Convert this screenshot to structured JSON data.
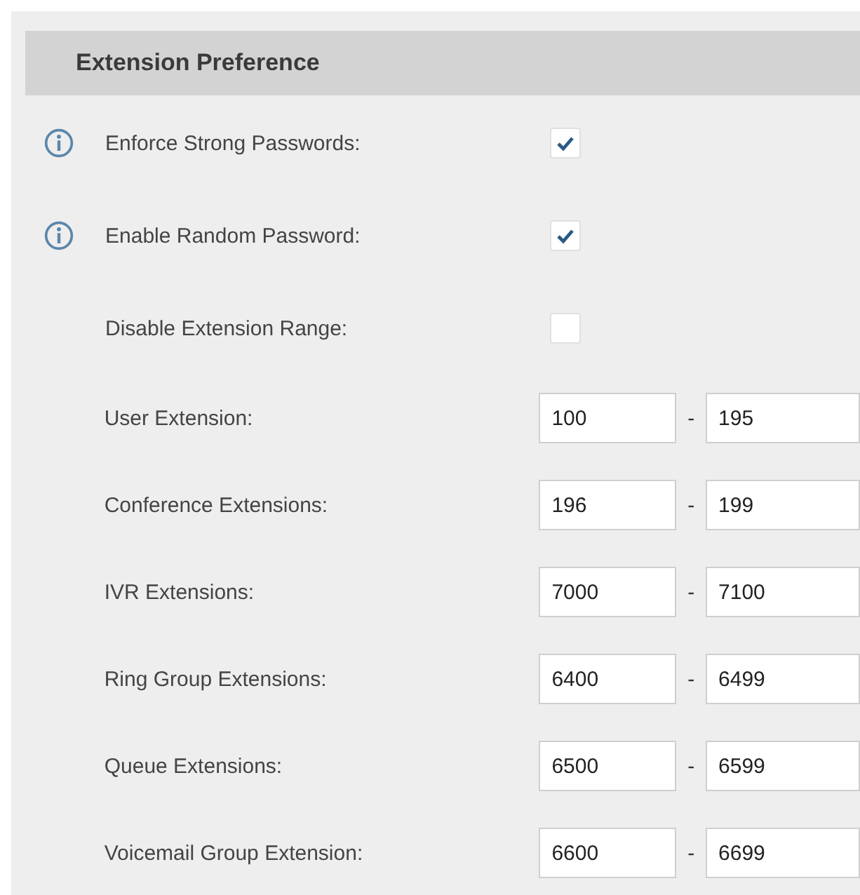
{
  "section": {
    "title": "Extension Preference"
  },
  "rows": [
    {
      "kind": "checkbox",
      "label": "Enforce Strong Passwords:",
      "info": true,
      "checked": true
    },
    {
      "kind": "checkbox",
      "label": "Enable Random Password:",
      "info": true,
      "checked": true
    },
    {
      "kind": "checkbox",
      "label": "Disable Extension Range:",
      "info": false,
      "checked": false
    },
    {
      "kind": "range",
      "label": "User Extension:",
      "start": "100",
      "separator": "-",
      "end": "195"
    },
    {
      "kind": "range",
      "label": "Conference Extensions:",
      "start": "196",
      "separator": "-",
      "end": "199"
    },
    {
      "kind": "range",
      "label": "IVR Extensions:",
      "start": "7000",
      "separator": "-",
      "end": "7100"
    },
    {
      "kind": "range",
      "label": "Ring Group Extensions:",
      "start": "6400",
      "separator": "-",
      "end": "6499"
    },
    {
      "kind": "range",
      "label": "Queue Extensions:",
      "start": "6500",
      "separator": "-",
      "end": "6599"
    },
    {
      "kind": "range",
      "label": "Voicemail Group Extension:",
      "start": "6600",
      "separator": "-",
      "end": "6699"
    }
  ]
}
